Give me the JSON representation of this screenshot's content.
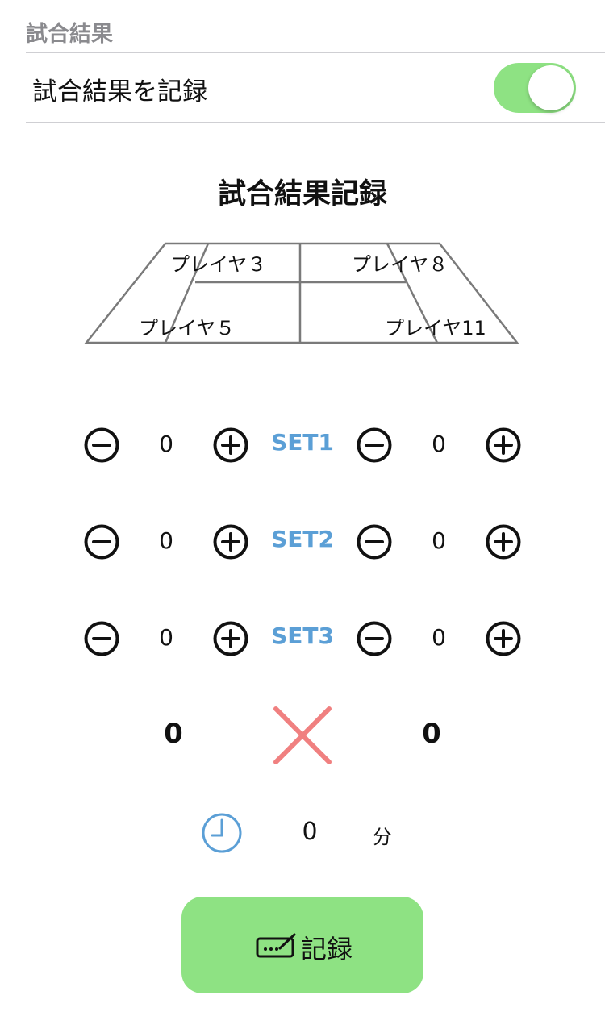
{
  "section": {
    "header": "試合結果"
  },
  "toggle_row": {
    "label": "試合結果を記録",
    "on": true
  },
  "record": {
    "title": "試合結果記録"
  },
  "court": {
    "players": {
      "top_left": "プレイヤ３",
      "top_right": "プレイヤ８",
      "bottom_left": "プレイヤ５",
      "bottom_right": "プレイヤ11"
    }
  },
  "sets": [
    {
      "label": "SET1",
      "left_score": "0",
      "right_score": "0"
    },
    {
      "label": "SET2",
      "left_score": "0",
      "right_score": "0"
    },
    {
      "label": "SET3",
      "left_score": "0",
      "right_score": "0"
    }
  ],
  "totals": {
    "left": "0",
    "right": "0"
  },
  "duration": {
    "value": "0",
    "unit": "分"
  },
  "save": {
    "label": "記録"
  },
  "colors": {
    "accent_green": "#8ee283",
    "set_blue": "#5b9fd6",
    "cancel_red": "#f08080"
  },
  "icons": {
    "minus": "minus-circle-icon",
    "plus": "plus-circle-icon",
    "cancel": "close-icon",
    "clock": "clock-icon",
    "save": "signature-icon"
  }
}
